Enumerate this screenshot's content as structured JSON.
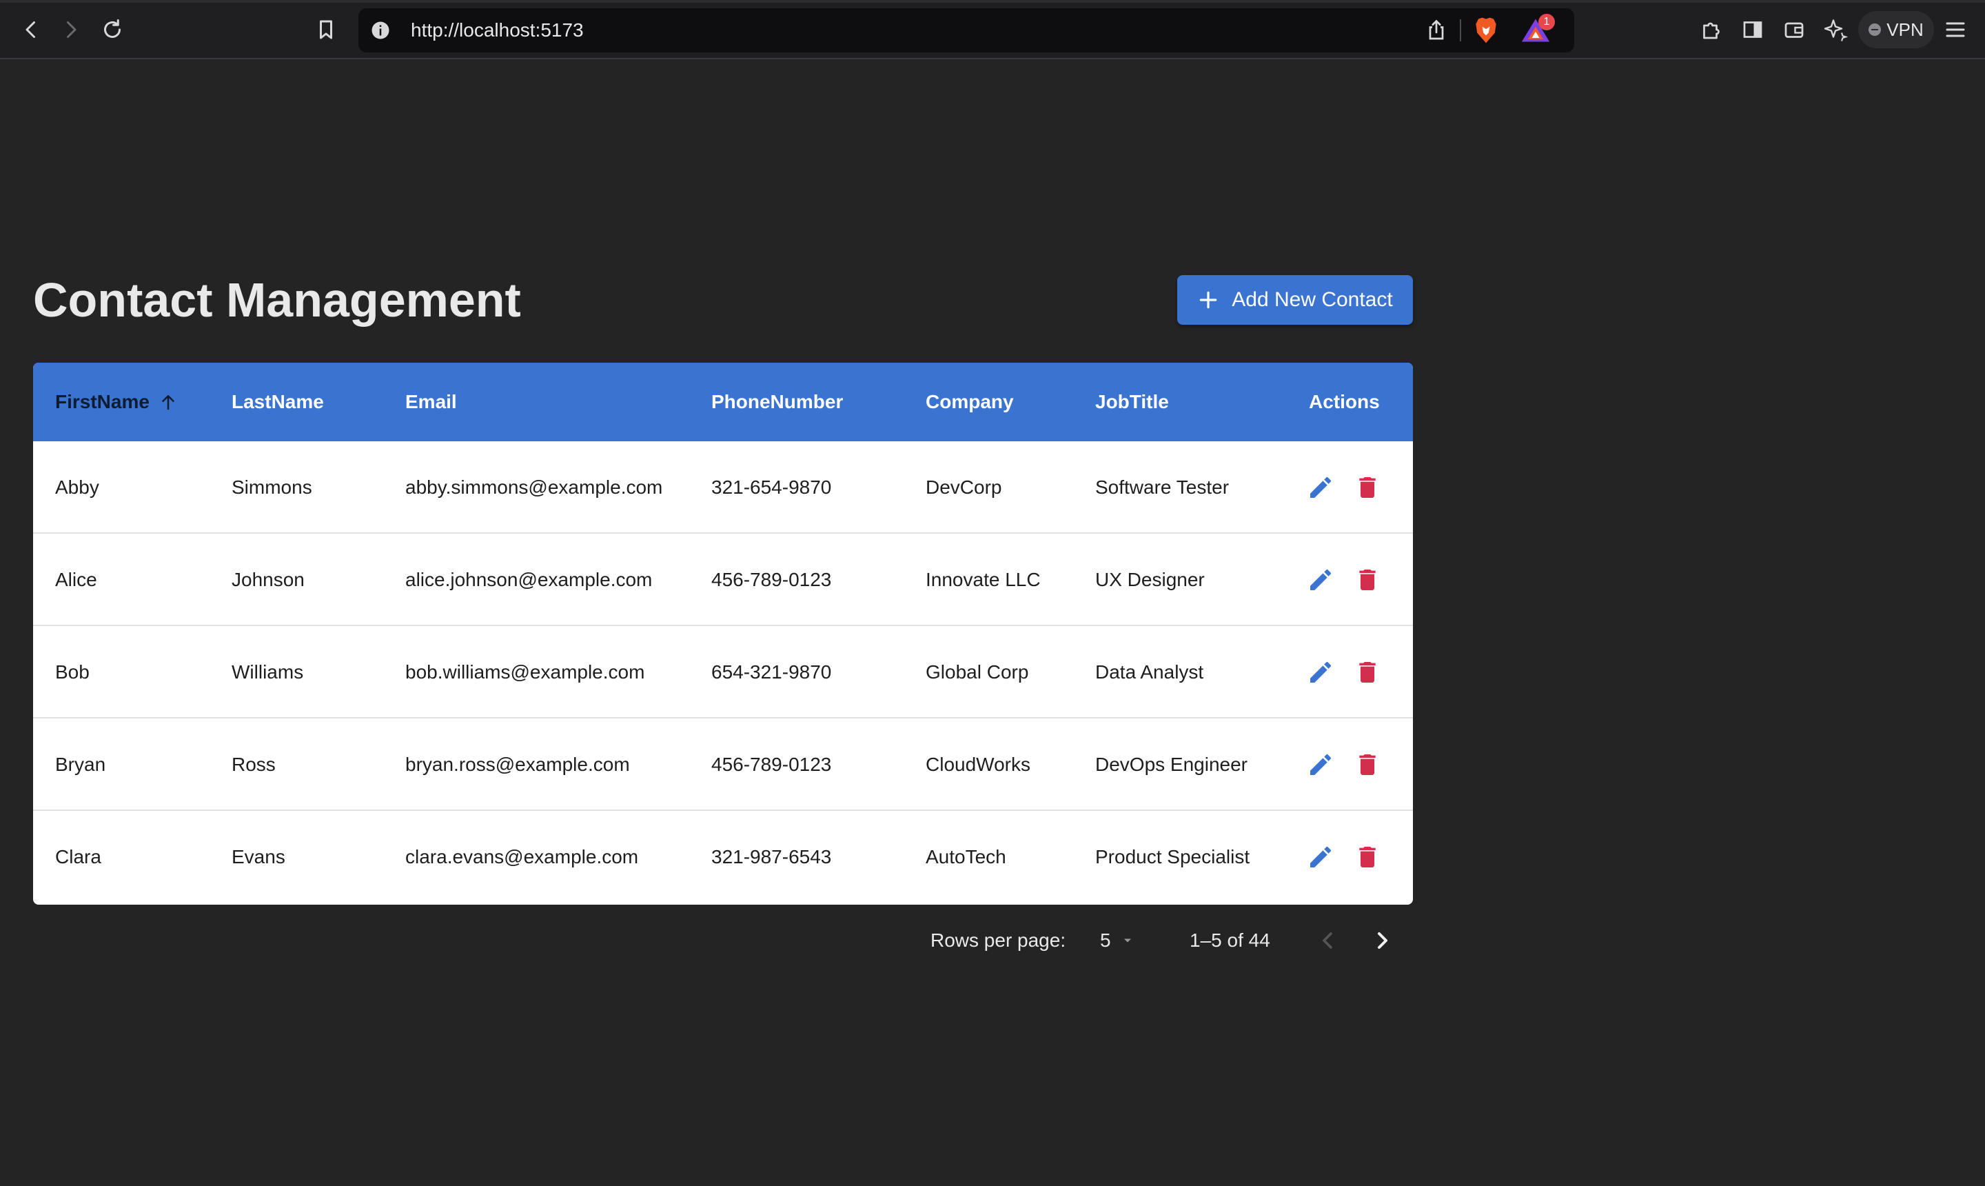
{
  "browser": {
    "url": "http://localhost:5173",
    "rewards_badge": "1",
    "vpn_label": "VPN"
  },
  "page": {
    "title": "Contact Management",
    "add_button_label": "Add New Contact"
  },
  "table": {
    "columns": [
      "FirstName",
      "LastName",
      "Email",
      "PhoneNumber",
      "Company",
      "JobTitle",
      "Actions"
    ],
    "sorted_column": "FirstName",
    "sort_direction": "ascending",
    "rows": [
      [
        "Abby",
        "Simmons",
        "abby.simmons@example.com",
        "321-654-9870",
        "DevCorp",
        "Software Tester"
      ],
      [
        "Alice",
        "Johnson",
        "alice.johnson@example.com",
        "456-789-0123",
        "Innovate LLC",
        "UX Designer"
      ],
      [
        "Bob",
        "Williams",
        "bob.williams@example.com",
        "654-321-9870",
        "Global Corp",
        "Data Analyst"
      ],
      [
        "Bryan",
        "Ross",
        "bryan.ross@example.com",
        "456-789-0123",
        "CloudWorks",
        "DevOps Engineer"
      ],
      [
        "Clara",
        "Evans",
        "clara.evans@example.com",
        "321-987-6543",
        "AutoTech",
        "Product Specialist"
      ]
    ]
  },
  "pagination": {
    "rows_per_page_label": "Rows per page:",
    "rows_per_page": "5",
    "range": "1–5 of 44"
  },
  "colors": {
    "header_bg": "#3b74d0",
    "edit_icon": "#3b74d0",
    "delete_icon": "#d32f4a",
    "page_bg": "#242424"
  }
}
